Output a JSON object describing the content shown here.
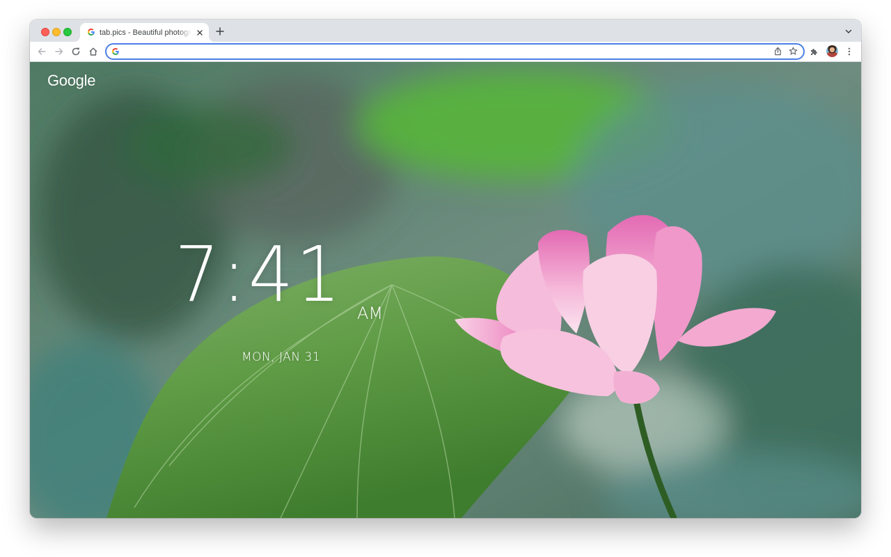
{
  "tab": {
    "title": "tab.pics - Beautiful photographs",
    "favicon_icon": "google-g-icon",
    "close_icon": "close-icon"
  },
  "tabstrip": {
    "new_tab_icon": "plus-icon",
    "tab_search_icon": "chevron-down-icon"
  },
  "toolbar": {
    "back_icon": "arrow-left-icon",
    "forward_icon": "arrow-right-icon",
    "reload_icon": "reload-icon",
    "home_icon": "home-icon",
    "extensions_icon": "puzzle-icon",
    "menu_icon": "kebab-menu-icon"
  },
  "omnibox": {
    "value": "",
    "placeholder": "",
    "share_icon": "share-icon",
    "bookmark_icon": "star-icon"
  },
  "newtab": {
    "logo": "Google",
    "time": "7:41",
    "ampm": "AM",
    "date": "MON, JAN 31"
  },
  "colors": {
    "tabstrip_bg": "#dee1e6",
    "omnibox_focus": "#4a7ee6",
    "traffic_red": "#fe5f57",
    "traffic_yellow": "#febc2e",
    "traffic_green": "#28c840"
  }
}
